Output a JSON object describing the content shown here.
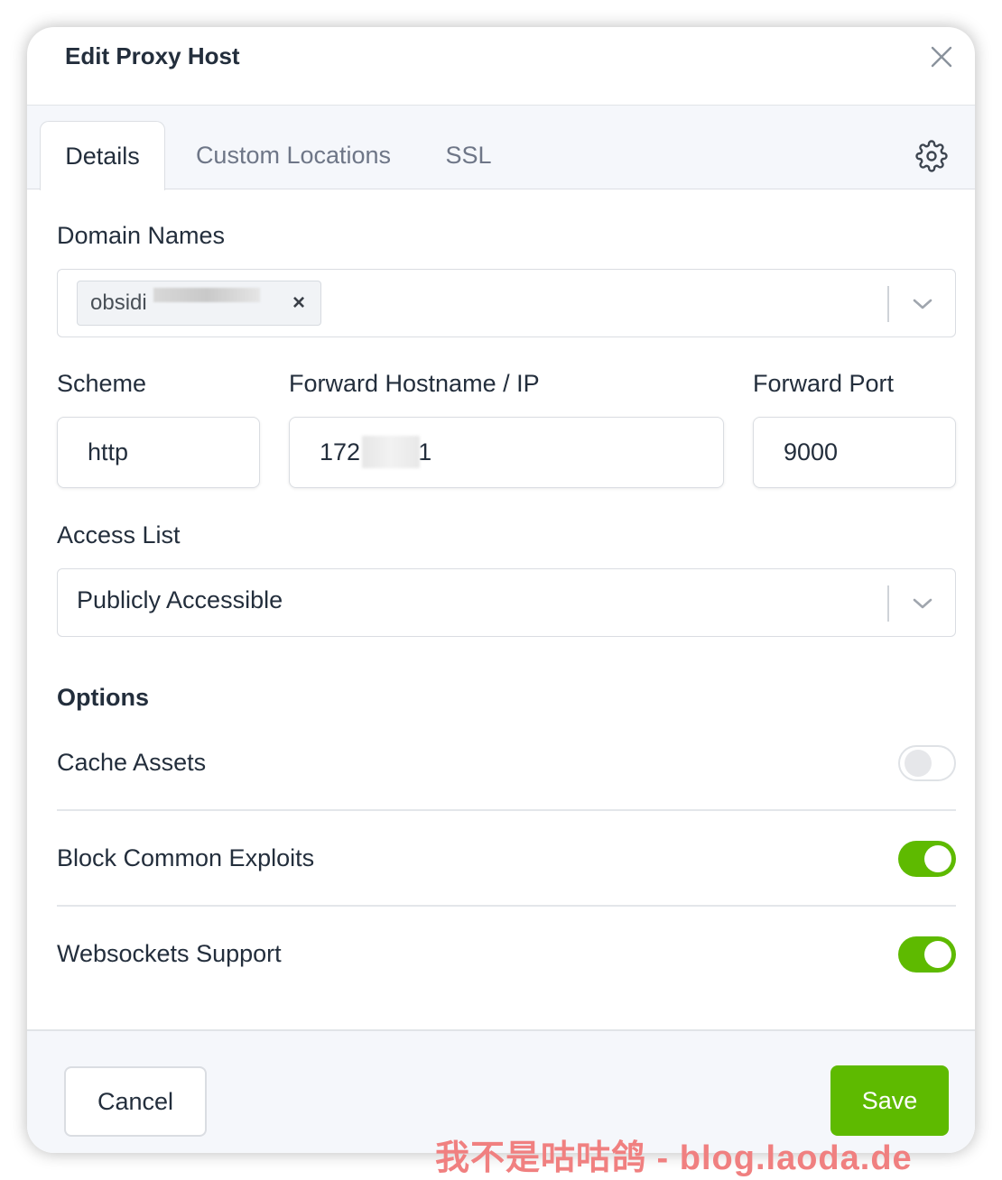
{
  "modal": {
    "title": "Edit Proxy Host"
  },
  "tabs": [
    {
      "label": "Details",
      "active": true
    },
    {
      "label": "Custom Locations",
      "active": false
    },
    {
      "label": "SSL",
      "active": false
    }
  ],
  "domain_names": {
    "label": "Domain Names",
    "chips": [
      {
        "value": "obsidi",
        "remove_label": "×"
      }
    ]
  },
  "scheme": {
    "label": "Scheme",
    "value": "http"
  },
  "forward_host": {
    "label": "Forward Hostname / IP",
    "value_prefix": "172",
    "value_suffix": "1"
  },
  "forward_port": {
    "label": "Forward Port",
    "value": "9000"
  },
  "access_list": {
    "label": "Access List",
    "value": "Publicly Accessible"
  },
  "options": {
    "heading": "Options",
    "items": [
      {
        "label": "Cache Assets",
        "enabled": false
      },
      {
        "label": "Block Common Exploits",
        "enabled": true
      },
      {
        "label": "Websockets Support",
        "enabled": true
      }
    ]
  },
  "footer": {
    "cancel_label": "Cancel",
    "save_label": "Save"
  },
  "watermark": "我不是咕咕鸽 - blog.laoda.de",
  "colors": {
    "accent": "#5eba00",
    "text": "#232e3c",
    "muted": "#6e7687",
    "watermark": "#f08080"
  }
}
